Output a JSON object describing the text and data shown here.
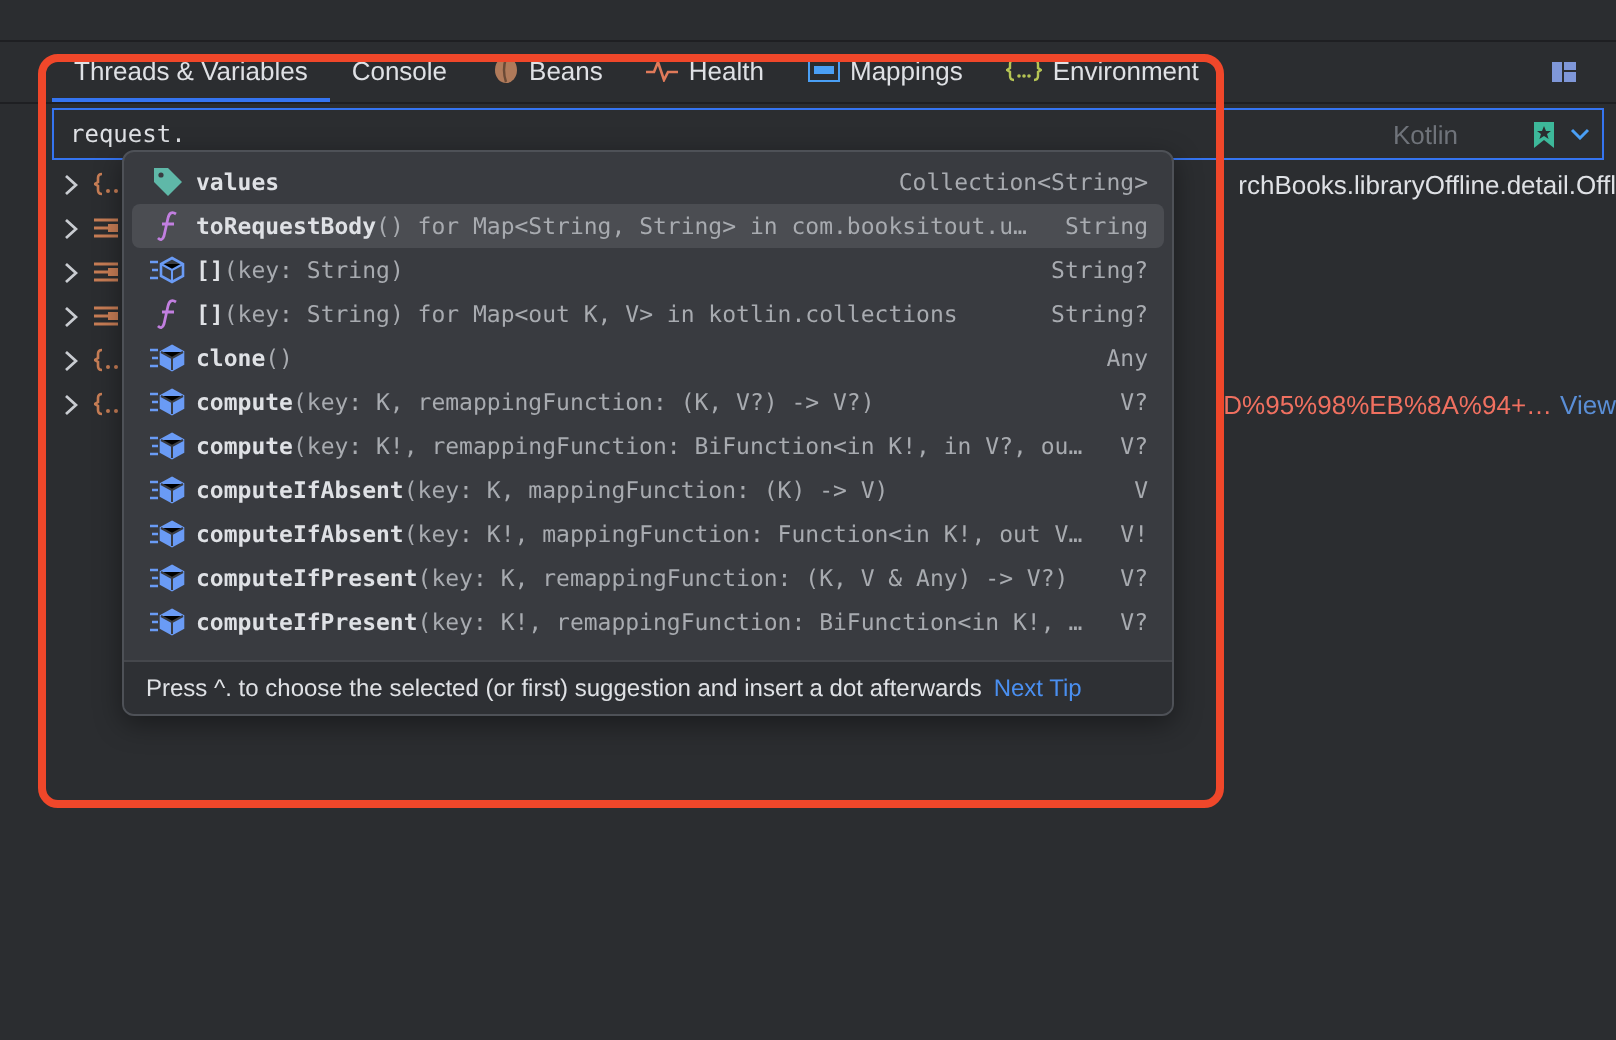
{
  "tabs": [
    {
      "label": "Threads & Variables",
      "selected": true
    },
    {
      "label": "Console",
      "selected": false
    },
    {
      "label": "Beans",
      "selected": false
    },
    {
      "label": "Health",
      "selected": false
    },
    {
      "label": "Mappings",
      "selected": false
    },
    {
      "label": "Environment",
      "selected": false
    }
  ],
  "expression": {
    "value": "request.",
    "language": "Kotlin"
  },
  "tree": [
    {
      "kind": "object",
      "expanded": false,
      "value": "rchBooks.libraryOffline.detail.Offl"
    },
    {
      "kind": "list",
      "expanded": false
    },
    {
      "kind": "list",
      "expanded": false
    },
    {
      "kind": "list",
      "expanded": false
    },
    {
      "kind": "object",
      "expanded": false
    },
    {
      "kind": "object",
      "expanded": false,
      "value": "D%95%98%EB%8A%94+…",
      "link": "View"
    }
  ],
  "completion": {
    "items": [
      {
        "kind": "property",
        "name": "values",
        "type": "Collection<String>",
        "selected": false
      },
      {
        "kind": "extension",
        "name": "toRequestBody",
        "signature": "() for Map<String, String> in com.booksitout.u…",
        "type": "String",
        "selected": true
      },
      {
        "kind": "abstract",
        "name": "[]",
        "signature": "(key: String)",
        "type": "String?",
        "selected": false
      },
      {
        "kind": "extension",
        "name": "[]",
        "signature": "(key: String) for Map<out K, V> in kotlin.collections",
        "type": "String?",
        "selected": false
      },
      {
        "kind": "method",
        "name": "clone",
        "signature": "()",
        "type": "Any",
        "selected": false
      },
      {
        "kind": "method",
        "name": "compute",
        "signature": "(key: K, remappingFunction: (K, V?) -> V?)",
        "type": "V?",
        "selected": false
      },
      {
        "kind": "method",
        "name": "compute",
        "signature": "(key: K!, remappingFunction: BiFunction<in K!, in V?, ou…",
        "type": "V?",
        "selected": false
      },
      {
        "kind": "method",
        "name": "computeIfAbsent",
        "signature": "(key: K, mappingFunction: (K) -> V)",
        "type": "V",
        "selected": false
      },
      {
        "kind": "method",
        "name": "computeIfAbsent",
        "signature": "(key: K!, mappingFunction: Function<in K!, out V…",
        "type": "V!",
        "selected": false
      },
      {
        "kind": "method",
        "name": "computeIfPresent",
        "signature": "(key: K, remappingFunction: (K, V & Any) -> V?)",
        "type": "V?",
        "selected": false
      },
      {
        "kind": "method",
        "name": "computeIfPresent",
        "signature": "(key: K!, remappingFunction: BiFunction<in K!, …",
        "type": "V?",
        "selected": false
      }
    ],
    "hint": "Press ^. to choose the selected (or first) suggestion and insert a dot afterwards",
    "tip_link": "Next Tip"
  }
}
